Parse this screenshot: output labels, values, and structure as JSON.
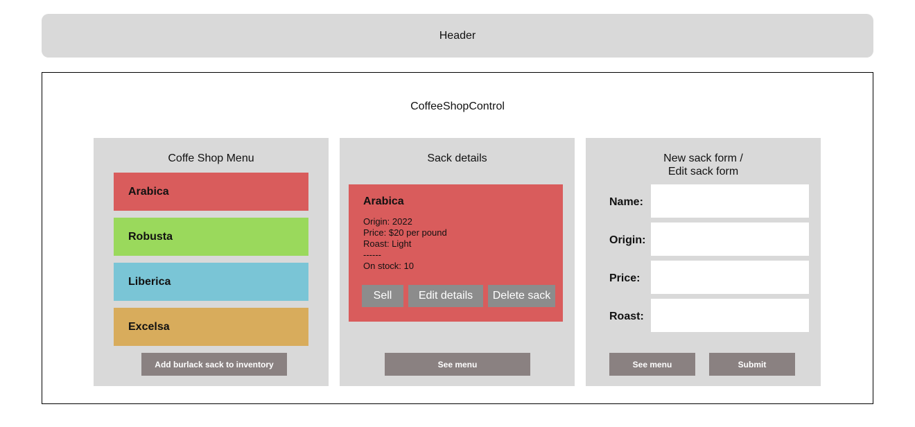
{
  "header": {
    "label": "Header"
  },
  "control": {
    "title": "CoffeeShopControl"
  },
  "menu": {
    "title": "Coffe Shop Menu",
    "items": [
      {
        "name": "Arabica",
        "color": "#d95c5c"
      },
      {
        "name": "Robusta",
        "color": "#9ad95c"
      },
      {
        "name": "Liberica",
        "color": "#7ac5d6"
      },
      {
        "name": "Excelsa",
        "color": "#d8ac5c"
      }
    ],
    "add_button": "Add burlack sack to inventory"
  },
  "details": {
    "title": "Sack details",
    "sack": {
      "name": "Arabica",
      "origin": "Origin: 2022",
      "price": "Price: $20 per pound",
      "roast": "Roast: Light",
      "divider": "------",
      "stock": "On stock: 10"
    },
    "buttons": {
      "sell": "Sell",
      "edit": "Edit details",
      "delete": "Delete sack"
    },
    "see_menu": "See menu"
  },
  "form": {
    "title_line1": "New sack form /",
    "title_line2": "Edit sack form",
    "labels": {
      "name": "Name:",
      "origin": "Origin:",
      "price": "Price:",
      "roast": "Roast:"
    },
    "see_menu": "See menu",
    "submit": "Submit"
  }
}
